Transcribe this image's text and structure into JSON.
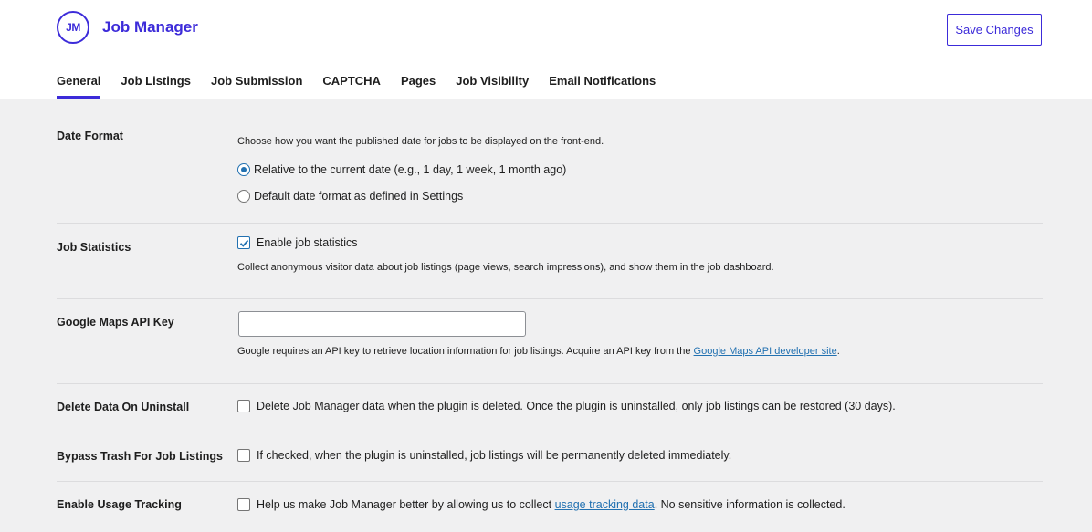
{
  "header": {
    "logo_text": "JM",
    "brand": "Job Manager",
    "save_label": "Save Changes"
  },
  "tabs": [
    {
      "label": "General",
      "active": true
    },
    {
      "label": "Job Listings"
    },
    {
      "label": "Job Submission"
    },
    {
      "label": "CAPTCHA"
    },
    {
      "label": "Pages"
    },
    {
      "label": "Job Visibility"
    },
    {
      "label": "Email Notifications"
    }
  ],
  "settings": {
    "date_format": {
      "label": "Date Format",
      "description": "Choose how you want the published date for jobs to be displayed on the front-end.",
      "options": [
        {
          "label": "Relative to the current date (e.g., 1 day, 1 week, 1 month ago)",
          "selected": true
        },
        {
          "label": "Default date format as defined in Settings",
          "selected": false
        }
      ]
    },
    "job_statistics": {
      "label": "Job Statistics",
      "checkbox_label": "Enable job statistics",
      "checked": true,
      "description": "Collect anonymous visitor data about job listings (page views, search impressions), and show them in the job dashboard."
    },
    "google_maps": {
      "label": "Google Maps API Key",
      "value": "",
      "description_prefix": "Google requires an API key to retrieve location information for job listings. Acquire an API key from the ",
      "link_text": "Google Maps API developer site",
      "description_suffix": "."
    },
    "delete_data": {
      "label": "Delete Data On Uninstall",
      "checkbox_label": "Delete Job Manager data when the plugin is deleted. Once the plugin is uninstalled, only job listings can be restored (30 days).",
      "checked": false
    },
    "bypass_trash": {
      "label": "Bypass Trash For Job Listings",
      "checkbox_label": "If checked, when the plugin is uninstalled, job listings will be permanently deleted immediately.",
      "checked": false
    },
    "usage_tracking": {
      "label": "Enable Usage Tracking",
      "text_prefix": "Help us make Job Manager better by allowing us to collect ",
      "link_text": "usage tracking data",
      "text_suffix": ". No sensitive information is collected.",
      "checked": false
    }
  },
  "colors": {
    "accent": "#3c2bd9",
    "link": "#2271b1",
    "background": "#f0f0f1"
  }
}
